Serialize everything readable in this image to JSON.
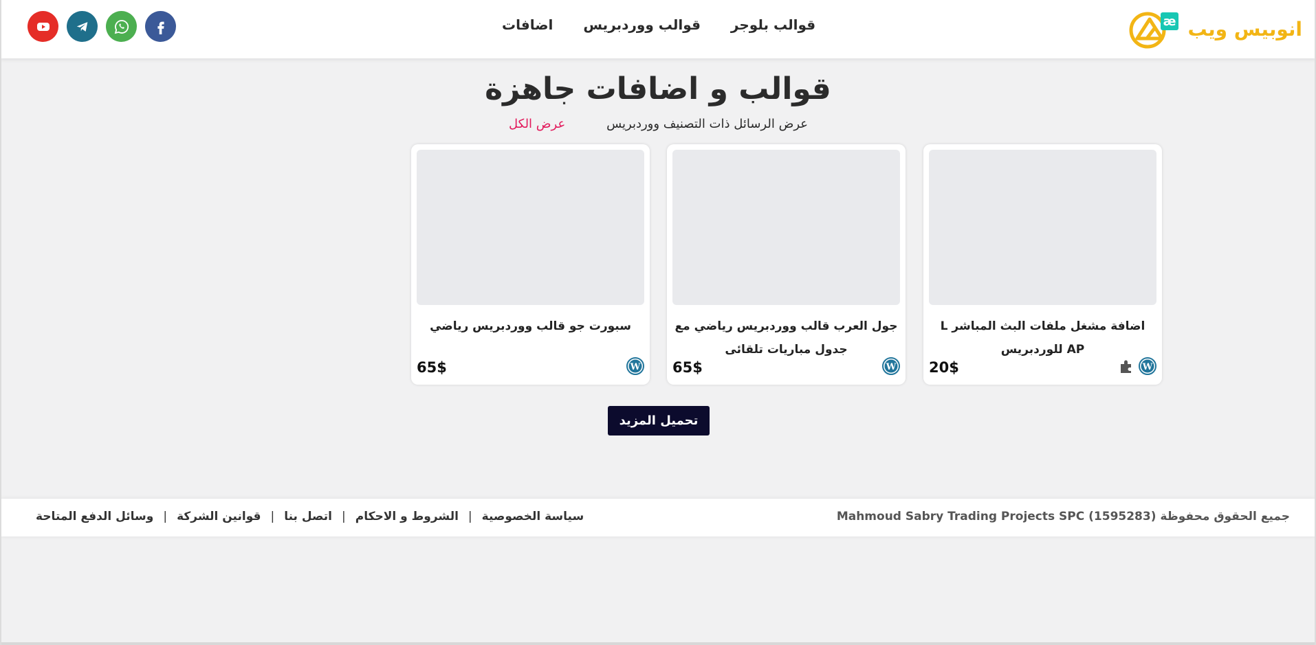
{
  "header": {
    "logo_text": "انوبيس ويب",
    "nav": [
      "قوالب بلوجر",
      "قوالب ووردبريس",
      "اضافات"
    ],
    "social": [
      {
        "name": "facebook",
        "color": "#3b5998"
      },
      {
        "name": "whatsapp",
        "color": "#4caf50"
      },
      {
        "name": "telegram",
        "color": "#1f6f8b"
      },
      {
        "name": "youtube",
        "color": "#e52d27"
      }
    ]
  },
  "main": {
    "title": "قوالب و اضافات جاهزة",
    "category_text": "عرض الرسائل ذات التصنيف ووردبريس",
    "show_all": "عرض الكل",
    "cards": [
      {
        "title": "اضافة مشغل ملفات البث المباشر L AP للوردبريس",
        "price": "20$",
        "icons": [
          "wordpress-icon",
          "plugin-icon"
        ]
      },
      {
        "title": "جول العرب قالب ووردبريس رياضي مع جدول مباريات تلقائى",
        "price": "65$",
        "icons": [
          "wordpress-icon"
        ]
      },
      {
        "title": "سبورت جو قالب ووردبريس رياضي",
        "price": "65$",
        "icons": [
          "wordpress-icon"
        ]
      }
    ],
    "load_more": "تحميل المزيد"
  },
  "footer": {
    "copyright": "جميع الحقوق محفوظة Mahmoud Sabry Trading Projects SPC (1595283)",
    "links": [
      "سياسة الخصوصية",
      "الشروط و الاحكام",
      "اتصل بنا",
      "قوانين الشركة",
      "وسائل الدفع المتاحة"
    ]
  },
  "colors": {
    "brand_yellow": "#f2b515",
    "brand_teal": "#18c7b3",
    "accent_pink": "#e2195b",
    "button_navy": "#0c0b2d",
    "wordpress_blue": "#21759b"
  }
}
